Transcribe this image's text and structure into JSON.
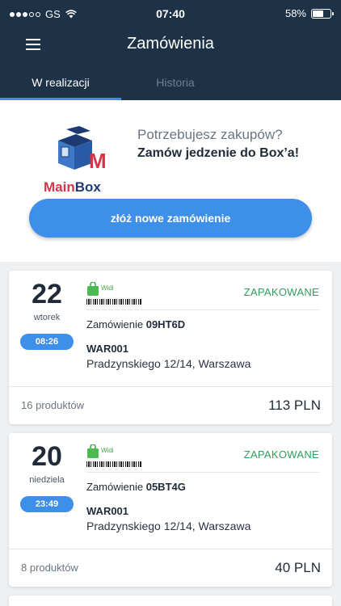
{
  "status_bar": {
    "carrier": "GS",
    "time": "07:40",
    "battery": "58%",
    "battery_level": 0.58
  },
  "header": {
    "title": "Zamówienia"
  },
  "tabs": [
    {
      "label": "W realizacji",
      "active": true
    },
    {
      "label": "Historia",
      "active": false
    }
  ],
  "promo": {
    "logo_text_1": "Main",
    "logo_text_2": "Box",
    "line1": "Potrzebujesz zakupów?",
    "line2": "Zamów jedzenie do Box’a!",
    "button_label": "złóż nowe zamówienie"
  },
  "orders": [
    {
      "day": "22",
      "weekday": "wtorek",
      "time": "08:26",
      "shop": "Widi",
      "status": "ZAPAKOWANE",
      "order_label": "Zamówienie",
      "order_id": "09HT6D",
      "code": "WAR001",
      "address": "Pradzynskiego 12/14, Warszawa",
      "products": "16 produktów",
      "price": "113 PLN"
    },
    {
      "day": "20",
      "weekday": "niedziela",
      "time": "23:49",
      "shop": "Widi",
      "status": "ZAPAKOWANE",
      "order_label": "Zamówienie",
      "order_id": "05BT4G",
      "code": "WAR001",
      "address": "Pradzynskiego 12/14, Warszawa",
      "products": "8 produktów",
      "price": "40 PLN"
    }
  ],
  "colors": {
    "header_bg": "#1d3246",
    "accent": "#3d8fea",
    "status_green": "#2e9e5b",
    "logo_red": "#d6344a",
    "logo_navy": "#1d3a72"
  }
}
